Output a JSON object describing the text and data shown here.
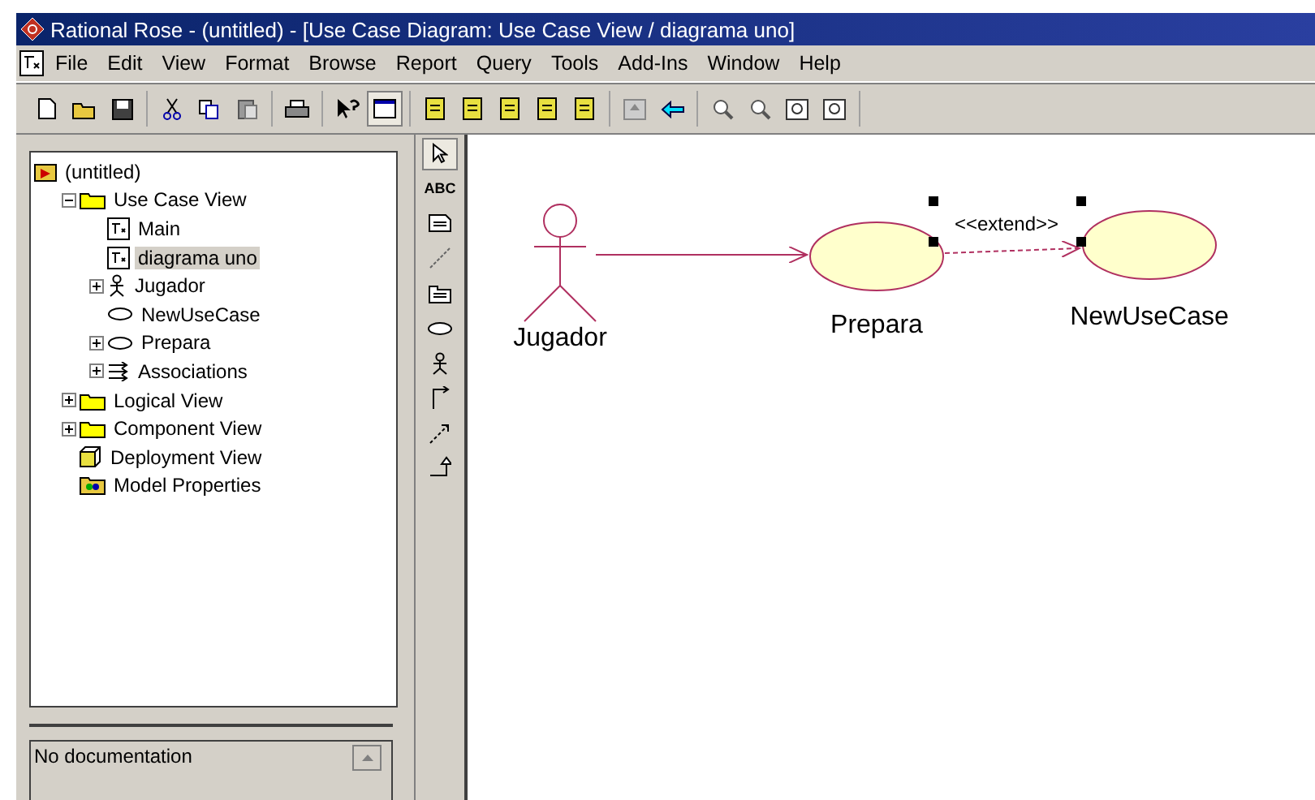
{
  "window": {
    "title": "Rational Rose - (untitled) - [Use Case Diagram: Use Case View / diagrama uno]"
  },
  "menu": [
    "File",
    "Edit",
    "View",
    "Format",
    "Browse",
    "Report",
    "Query",
    "Tools",
    "Add-Ins",
    "Window",
    "Help"
  ],
  "toolbar": [
    [
      {
        "kind": "new",
        "pressed": false
      },
      {
        "kind": "open",
        "pressed": false
      },
      {
        "kind": "save",
        "pressed": false
      }
    ],
    [
      {
        "kind": "cut",
        "pressed": false
      },
      {
        "kind": "copy",
        "pressed": false
      },
      {
        "kind": "paste",
        "pressed": false
      }
    ],
    [
      {
        "kind": "print",
        "pressed": false
      }
    ],
    [
      {
        "kind": "help",
        "pressed": false
      },
      {
        "kind": "browser",
        "pressed": true
      }
    ],
    [
      {
        "kind": "doc",
        "pressed": false
      },
      {
        "kind": "doc",
        "pressed": false
      },
      {
        "kind": "doc",
        "pressed": false
      },
      {
        "kind": "doc",
        "pressed": false
      },
      {
        "kind": "doc",
        "pressed": false
      }
    ],
    [
      {
        "kind": "up",
        "pressed": false
      },
      {
        "kind": "back",
        "pressed": false
      }
    ],
    [
      {
        "kind": "zoom",
        "pressed": false
      },
      {
        "kind": "zoom",
        "pressed": false
      },
      {
        "kind": "fit",
        "pressed": false
      },
      {
        "kind": "fit",
        "pressed": false
      }
    ]
  ],
  "tree": [
    {
      "label": "(untitled)",
      "kind": "model",
      "selected": false,
      "children": [
        {
          "label": "Use Case View",
          "kind": "folder",
          "expanded": true,
          "selected": false,
          "children": [
            {
              "label": "Main",
              "kind": "diagram",
              "selected": false
            },
            {
              "label": "diagrama uno",
              "kind": "diagram",
              "selected": true
            },
            {
              "label": "Jugador",
              "kind": "actor",
              "expanded": false,
              "selected": false
            },
            {
              "label": "NewUseCase",
              "kind": "usecase",
              "selected": false
            },
            {
              "label": "Prepara",
              "kind": "usecase",
              "expanded": false,
              "selected": false
            },
            {
              "label": "Associations",
              "kind": "associations",
              "expanded": false,
              "selected": false
            }
          ]
        },
        {
          "label": "Logical View",
          "kind": "folder",
          "expanded": false,
          "selected": false
        },
        {
          "label": "Component View",
          "kind": "folder",
          "expanded": false,
          "selected": false
        },
        {
          "label": "Deployment View",
          "kind": "deployment",
          "selected": false
        },
        {
          "label": "Model Properties",
          "kind": "properties",
          "selected": false
        }
      ]
    }
  ],
  "documentation": {
    "text": "No documentation"
  },
  "tools": [
    {
      "kind": "pointer",
      "selected": true
    },
    {
      "kind": "text",
      "label": "ABC",
      "selected": false
    },
    {
      "kind": "note",
      "selected": false
    },
    {
      "kind": "anchor",
      "selected": false
    },
    {
      "kind": "package",
      "selected": false
    },
    {
      "kind": "usecase",
      "selected": false
    },
    {
      "kind": "actor",
      "selected": false
    },
    {
      "kind": "association",
      "selected": false
    },
    {
      "kind": "dependency",
      "selected": false
    },
    {
      "kind": "generalization",
      "selected": false
    }
  ],
  "diagram": {
    "actors": [
      {
        "name": "Jugador"
      }
    ],
    "use_cases": [
      {
        "name": "Prepara"
      },
      {
        "name": "NewUseCase"
      }
    ],
    "relations": [
      {
        "kind": "association"
      },
      {
        "kind": "extend",
        "label": "<<extend>>",
        "selected": true
      }
    ]
  }
}
